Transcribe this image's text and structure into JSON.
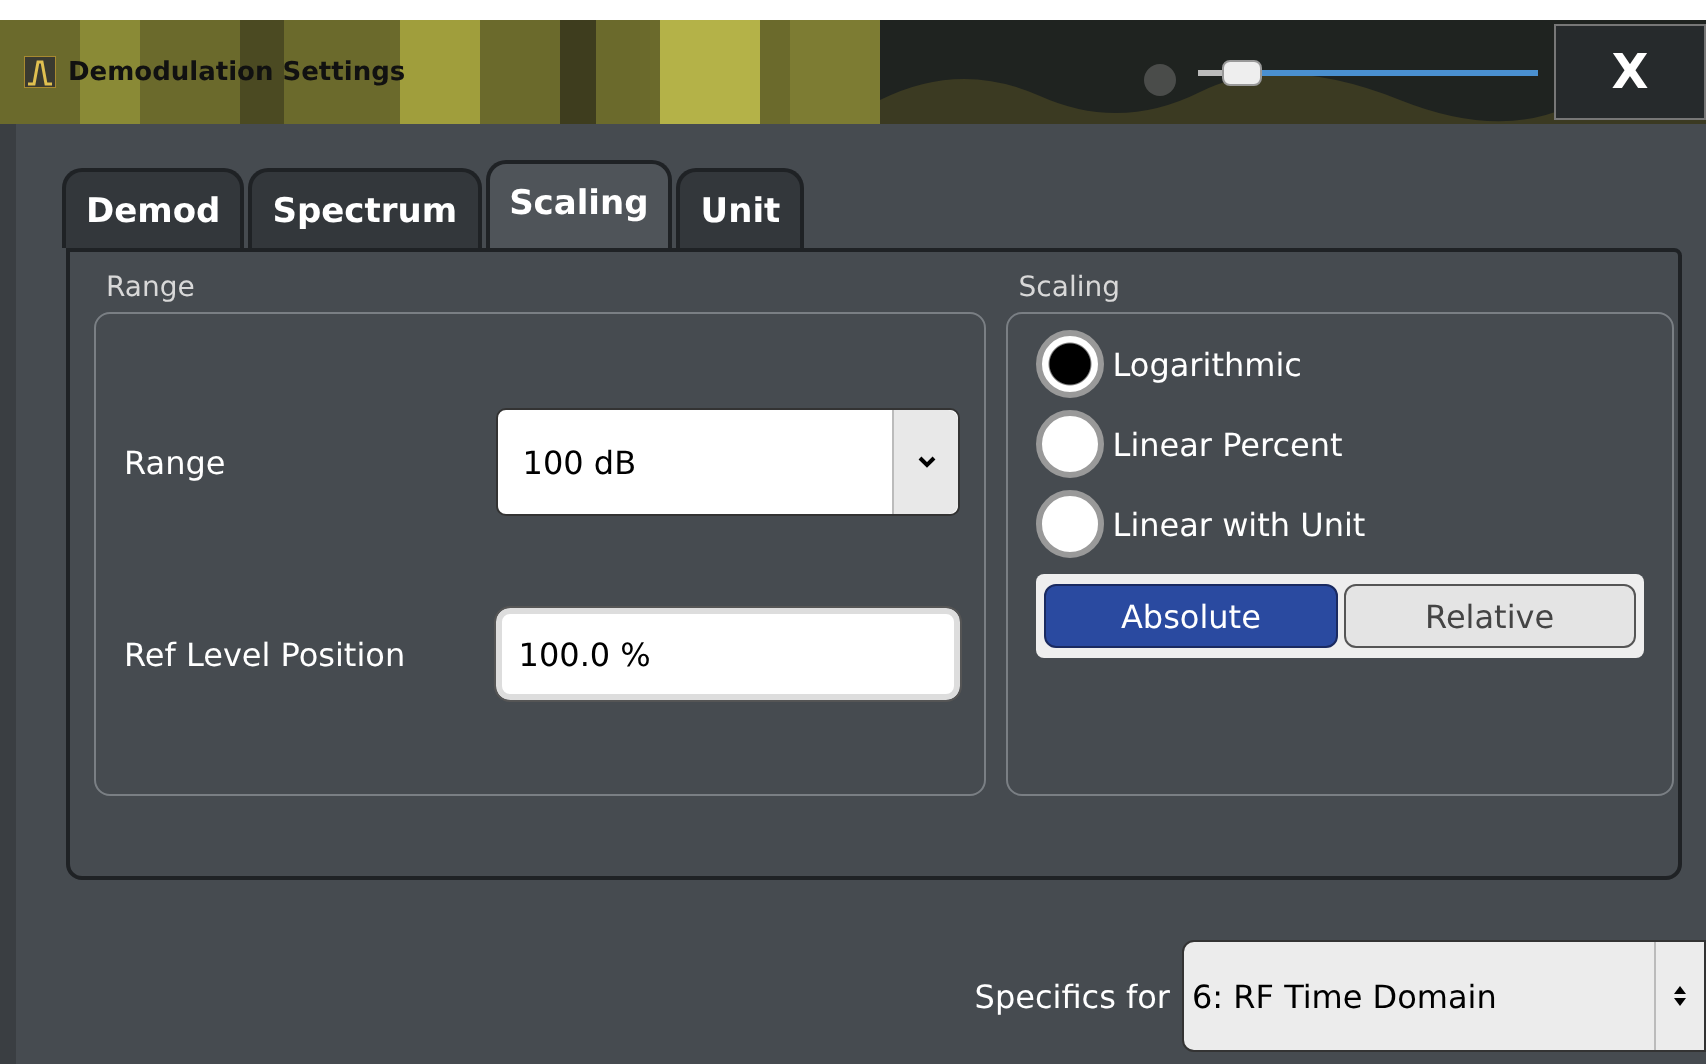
{
  "window": {
    "title": "Demodulation Settings",
    "transparency_slider": {
      "level": 0.08
    },
    "close": "X"
  },
  "tabs": [
    {
      "label": "Demod",
      "selected": false
    },
    {
      "label": "Spectrum",
      "selected": false
    },
    {
      "label": "Scaling",
      "selected": true
    },
    {
      "label": "Unit",
      "selected": false
    }
  ],
  "range_group": {
    "title": "Range",
    "range": {
      "label": "Range",
      "value": "100 dB"
    },
    "ref_level_position": {
      "label": "Ref Level Position",
      "value": "100.0 %"
    }
  },
  "scaling_group": {
    "title": "Scaling",
    "options": [
      {
        "label": "Logarithmic",
        "selected": true
      },
      {
        "label": "Linear Percent",
        "selected": false
      },
      {
        "label": "Linear with Unit",
        "selected": false
      }
    ],
    "mode": [
      {
        "label": "Absolute",
        "selected": true
      },
      {
        "label": "Relative",
        "selected": false
      }
    ]
  },
  "specifics": {
    "label": "Specifics for",
    "value": "6: RF Time Domain"
  }
}
